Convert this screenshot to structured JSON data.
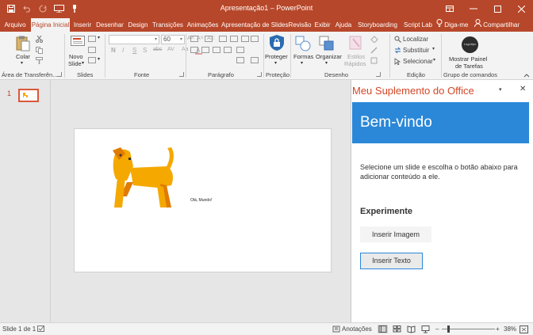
{
  "title_bar": {
    "document_title": "Apresentação1 – PowerPoint",
    "qat_icons": [
      "save-icon",
      "undo-icon",
      "redo-icon",
      "presenter-icon",
      "brush-icon"
    ],
    "window_controls": [
      "ribbon-display-icon",
      "minimize-icon",
      "maximize-icon",
      "close-icon"
    ]
  },
  "tabs": [
    {
      "label": "Arquivo",
      "active": false
    },
    {
      "label": "Página Inicial",
      "active": true
    },
    {
      "label": "Inserir",
      "active": false
    },
    {
      "label": "Desenhar",
      "active": false
    },
    {
      "label": "Design",
      "active": false
    },
    {
      "label": "Transições",
      "active": false
    },
    {
      "label": "Animações",
      "active": false
    },
    {
      "label": "Apresentação de Slides",
      "active": false
    },
    {
      "label": "Revisão",
      "active": false
    },
    {
      "label": "Exibir",
      "active": false
    },
    {
      "label": "Ajuda",
      "active": false
    },
    {
      "label": "Storyboarding",
      "active": false
    },
    {
      "label": "Script Lab",
      "active": false
    }
  ],
  "tell_me": "Diga-me",
  "share": "Compartilhar",
  "ribbon": {
    "clipboard": {
      "paste": "Colar",
      "label": "Área de Transferên..."
    },
    "slides": {
      "new_slide_line1": "Novo",
      "new_slide_line2": "Slide",
      "label": "Slides"
    },
    "font": {
      "size": "60",
      "label": "Fonte",
      "format_buttons": [
        "N",
        "I",
        "S",
        "S",
        "abc",
        "AV",
        "Aa"
      ]
    },
    "paragraph": {
      "label": "Parágrafo"
    },
    "protection": {
      "protect": "Proteger",
      "label": "Proteção"
    },
    "drawing": {
      "shapes": "Formas",
      "arrange": "Organizar",
      "quick_styles_line1": "Estilos",
      "quick_styles_line2": "Rápidos",
      "label": "Desenho"
    },
    "editing": {
      "find": "Localizar",
      "replace": "Substituir",
      "select": "Selecionar",
      "label": "Edição"
    },
    "commands": {
      "logo": "Logotipo",
      "show_pane_line1": "Mostrar Painel",
      "show_pane_line2": "de Tarefas",
      "label": "Grupo de comandos"
    }
  },
  "thumbnails": [
    {
      "number": "1"
    }
  ],
  "slide": {
    "text": "Olá, Mundo!"
  },
  "task_pane": {
    "title": "Meu Suplemento do Office",
    "banner_title": "Bem-vindo",
    "instructions": "Selecione um slide e escolha o botão abaixo para adicionar conteúdo a ele.",
    "section_title": "Experimente",
    "insert_image": "Inserir Imagem",
    "insert_text": "Inserir Texto",
    "accent_color": "#2b88d8",
    "title_color": "#d24726"
  },
  "status_bar": {
    "slide_count": "Slide 1 de 1",
    "notes": "Anotações",
    "zoom": "38%"
  },
  "colors": {
    "brand": "#b7472a",
    "ribbon_bg": "#f3f3f3"
  }
}
